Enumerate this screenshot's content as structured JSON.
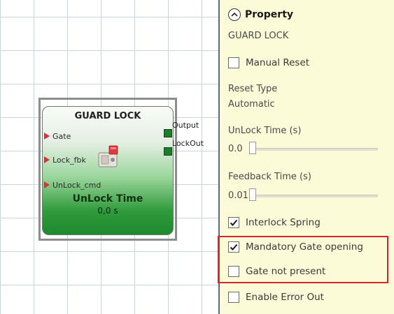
{
  "block": {
    "title": "GUARD LOCK",
    "inputs": [
      "Gate",
      "Lock_fbk",
      "UnLock_cmd"
    ],
    "outputs": [
      "Output",
      "LockOut"
    ],
    "param_name": "UnLock Time",
    "param_value": "0,0 s",
    "lock_icon": "lock-device-icon"
  },
  "property": {
    "header": "Property",
    "collapse_icon": "chevron-up-circle-icon",
    "block_name": "GUARD LOCK",
    "manual_reset": {
      "label": "Manual Reset",
      "checked": false
    },
    "reset_type": {
      "label": "Reset Type",
      "value": "Automatic"
    },
    "unlock_time": {
      "label": "UnLock Time (s)",
      "value": "0.0",
      "level": 0.0
    },
    "feedback_time": {
      "label": "Feedback Time (s)",
      "value": "0.01",
      "level": 0.0
    },
    "interlock_spring": {
      "label": "Interlock Spring",
      "checked": true
    },
    "mandatory_gate_opening": {
      "label": "Mandatory Gate opening",
      "checked": true
    },
    "gate_not_present": {
      "label": "Gate not present",
      "checked": false
    },
    "enable_error_out": {
      "label": "Enable Error Out",
      "checked": false
    }
  },
  "colors": {
    "panel_bg": "#fbfbd8",
    "highlight": "#d8232a",
    "block_green": "#2e9a3b",
    "input_arrow": "#e52a3a",
    "output_port": "#1e7d2a"
  }
}
